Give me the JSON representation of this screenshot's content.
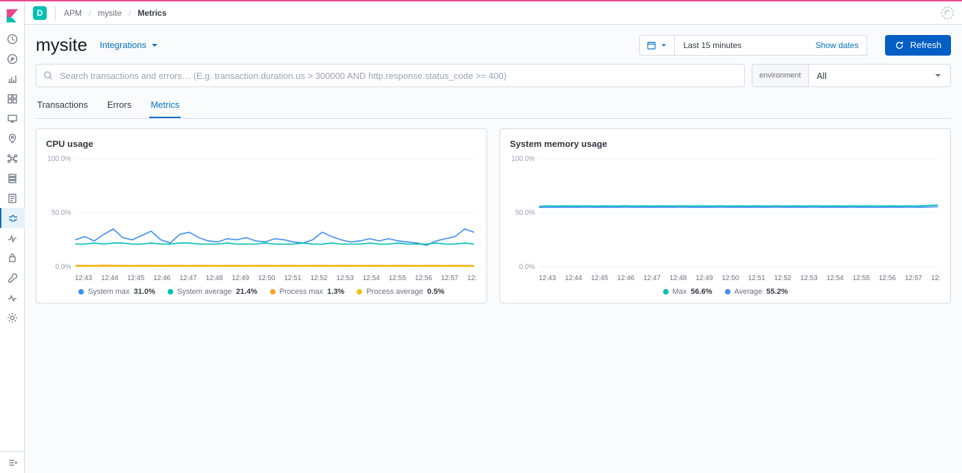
{
  "space_badge": "D",
  "breadcrumb": {
    "root": "APM",
    "service": "mysite",
    "current": "Metrics"
  },
  "page_title": "mysite",
  "integrations_label": "Integrations",
  "date_range": "Last 15 minutes",
  "show_dates_label": "Show dates",
  "refresh_label": "Refresh",
  "search": {
    "placeholder": "Search transactions and errors… (E.g. transaction.duration.us > 300000 AND http.response.status_code >= 400)"
  },
  "environment": {
    "label": "environment",
    "value": "All"
  },
  "tabs": {
    "t0": "Transactions",
    "t1": "Errors",
    "t2": "Metrics"
  },
  "panel_cpu_title": "CPU usage",
  "panel_mem_title": "System memory usage",
  "cpu_legend": {
    "s0": "System max",
    "v0": "31.0%",
    "s1": "System average",
    "v1": "21.4%",
    "s2": "Process max",
    "v2": "1.3%",
    "s3": "Process average",
    "v3": "0.5%"
  },
  "mem_legend": {
    "s0": "Max",
    "v0": "56.6%",
    "s1": "Average",
    "v1": "55.2%"
  },
  "chart_data": [
    {
      "type": "line",
      "title": "CPU usage",
      "ylabel": "%",
      "xlabel": "",
      "ylim": [
        0,
        100
      ],
      "y_ticks": [
        "0.0%",
        "50.0%",
        "100.0%"
      ],
      "x_categories": [
        "12:43",
        "12:44",
        "12:45",
        "12:46",
        "12:47",
        "12:48",
        "12:49",
        "12:50",
        "12:51",
        "12:52",
        "12:53",
        "12:54",
        "12:55",
        "12:56",
        "12:57",
        "12:"
      ],
      "series": [
        {
          "name": "System max",
          "color": "#3f8ff5",
          "values": [
            25,
            28,
            24,
            30,
            35,
            27,
            25,
            29,
            33,
            25,
            22,
            30,
            32,
            27,
            24,
            23,
            26,
            25,
            27,
            24,
            23,
            26,
            25,
            23,
            22,
            25,
            32,
            28,
            25,
            23,
            24,
            26,
            24,
            26,
            24,
            23,
            22,
            20,
            24,
            26,
            28,
            35,
            32
          ]
        },
        {
          "name": "System average",
          "color": "#00bfb3",
          "values": [
            21,
            21,
            22,
            21,
            22,
            22,
            21,
            21,
            22,
            21,
            21,
            22,
            22,
            21,
            21,
            21,
            22,
            21,
            21,
            21,
            22,
            21,
            21,
            21,
            22,
            21,
            21,
            22,
            21,
            21,
            21,
            22,
            21,
            21,
            22,
            21,
            21,
            21,
            22,
            21,
            21,
            22,
            21
          ]
        },
        {
          "name": "Process max",
          "color": "#f5a623",
          "values": [
            1.2,
            1.3,
            1.2,
            1.4,
            1.3,
            1.3,
            1.2,
            1.3,
            1.3,
            1.2,
            1.3,
            1.3,
            1.2,
            1.3,
            1.3,
            1.2,
            1.3,
            1.3,
            1.2,
            1.3,
            1.3,
            1.2,
            1.3,
            1.3,
            1.2,
            1.3,
            1.3,
            1.2,
            1.3,
            1.3,
            1.2,
            1.3,
            1.3,
            1.2,
            1.3,
            1.3,
            1.2,
            1.3,
            1.3,
            1.2,
            1.3,
            1.3,
            1.2
          ]
        },
        {
          "name": "Process average",
          "color": "#f0c419",
          "values": [
            0.5,
            0.5,
            0.5,
            0.5,
            0.5,
            0.5,
            0.5,
            0.5,
            0.5,
            0.5,
            0.5,
            0.5,
            0.5,
            0.5,
            0.5,
            0.5,
            0.5,
            0.5,
            0.5,
            0.5,
            0.5,
            0.5,
            0.5,
            0.5,
            0.5,
            0.5,
            0.5,
            0.5,
            0.5,
            0.5,
            0.5,
            0.5,
            0.5,
            0.5,
            0.5,
            0.5,
            0.5,
            0.5,
            0.5,
            0.5,
            0.5,
            0.5,
            0.5
          ]
        }
      ]
    },
    {
      "type": "line",
      "title": "System memory usage",
      "ylabel": "%",
      "xlabel": "",
      "ylim": [
        0,
        100
      ],
      "y_ticks": [
        "0.0%",
        "50.0%",
        "100.0%"
      ],
      "x_categories": [
        "12:43",
        "12:44",
        "12:45",
        "12:46",
        "12:47",
        "12:48",
        "12:49",
        "12:50",
        "12:51",
        "12:52",
        "12:53",
        "12:54",
        "12:55",
        "12:56",
        "12:57",
        "12:"
      ],
      "series": [
        {
          "name": "Max",
          "color": "#00bfb3",
          "values": [
            56,
            56.5,
            56.2,
            56.4,
            56.3,
            56.5,
            56.2,
            56.4,
            56.3,
            56.5,
            56.3,
            56.4,
            56.3,
            56.4,
            56.3,
            56.5,
            56.3,
            56.4,
            56.3,
            56.5,
            56.3,
            56.4,
            56.3,
            56.4,
            56.3,
            56.5,
            56.3,
            56.4,
            56.3,
            56.5,
            56.3,
            56.4,
            56.3,
            56.5,
            56.3,
            56.4,
            56.3,
            56.4,
            56.3,
            56.5,
            56.3,
            56.8,
            57.2
          ]
        },
        {
          "name": "Average",
          "color": "#3f8ff5",
          "values": [
            55,
            55.2,
            55.1,
            55.2,
            55.1,
            55.3,
            55.1,
            55.2,
            55.1,
            55.3,
            55.1,
            55.2,
            55.1,
            55.2,
            55.1,
            55.3,
            55.1,
            55.2,
            55.1,
            55.3,
            55.1,
            55.2,
            55.1,
            55.2,
            55.1,
            55.3,
            55.1,
            55.2,
            55.1,
            55.3,
            55.1,
            55.2,
            55.1,
            55.3,
            55.1,
            55.2,
            55.1,
            55.2,
            55.1,
            55.3,
            55.1,
            55.4,
            55.6
          ]
        }
      ]
    }
  ]
}
